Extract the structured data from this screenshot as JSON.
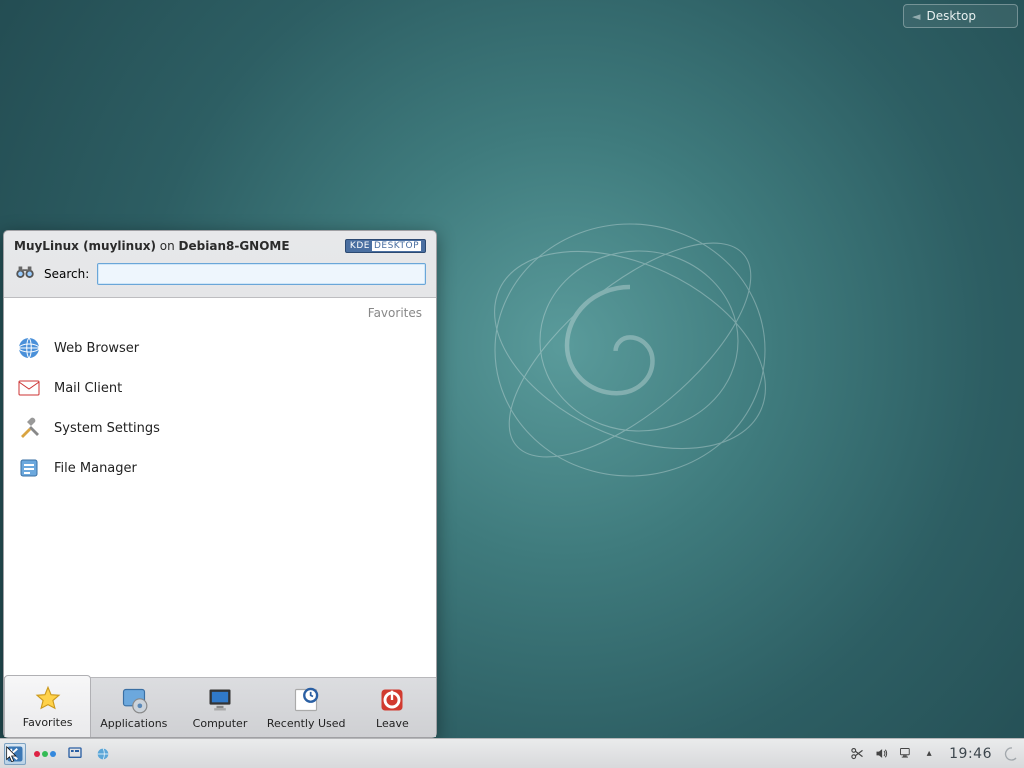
{
  "desktop_widget": {
    "label": "Desktop"
  },
  "startmenu": {
    "user_part1": "MuyLinux (muylinux)",
    "user_on": " on ",
    "user_part2": "Debian8-GNOME",
    "kde_logo_left": "KDE",
    "kde_logo_right": "DESKTOP",
    "search_label": "Search:",
    "section_title": "Favorites",
    "favorites": [
      {
        "label": "Web Browser",
        "icon": "globe-icon"
      },
      {
        "label": "Mail Client",
        "icon": "mail-icon"
      },
      {
        "label": "System Settings",
        "icon": "tools-icon"
      },
      {
        "label": "File Manager",
        "icon": "folder-icon"
      }
    ],
    "tabs": [
      {
        "label": "Favorites",
        "icon": "star-icon",
        "active": true
      },
      {
        "label": "Applications",
        "icon": "apps-icon",
        "active": false
      },
      {
        "label": "Computer",
        "icon": "computer-icon",
        "active": false
      },
      {
        "label": "Recently Used",
        "icon": "clock-icon",
        "active": false
      },
      {
        "label": "Leave",
        "icon": "power-icon",
        "active": false
      }
    ]
  },
  "panel": {
    "clock": "19:46",
    "tray_icons": [
      "scissors-icon",
      "volume-icon",
      "network-icon",
      "expand-icon"
    ]
  }
}
